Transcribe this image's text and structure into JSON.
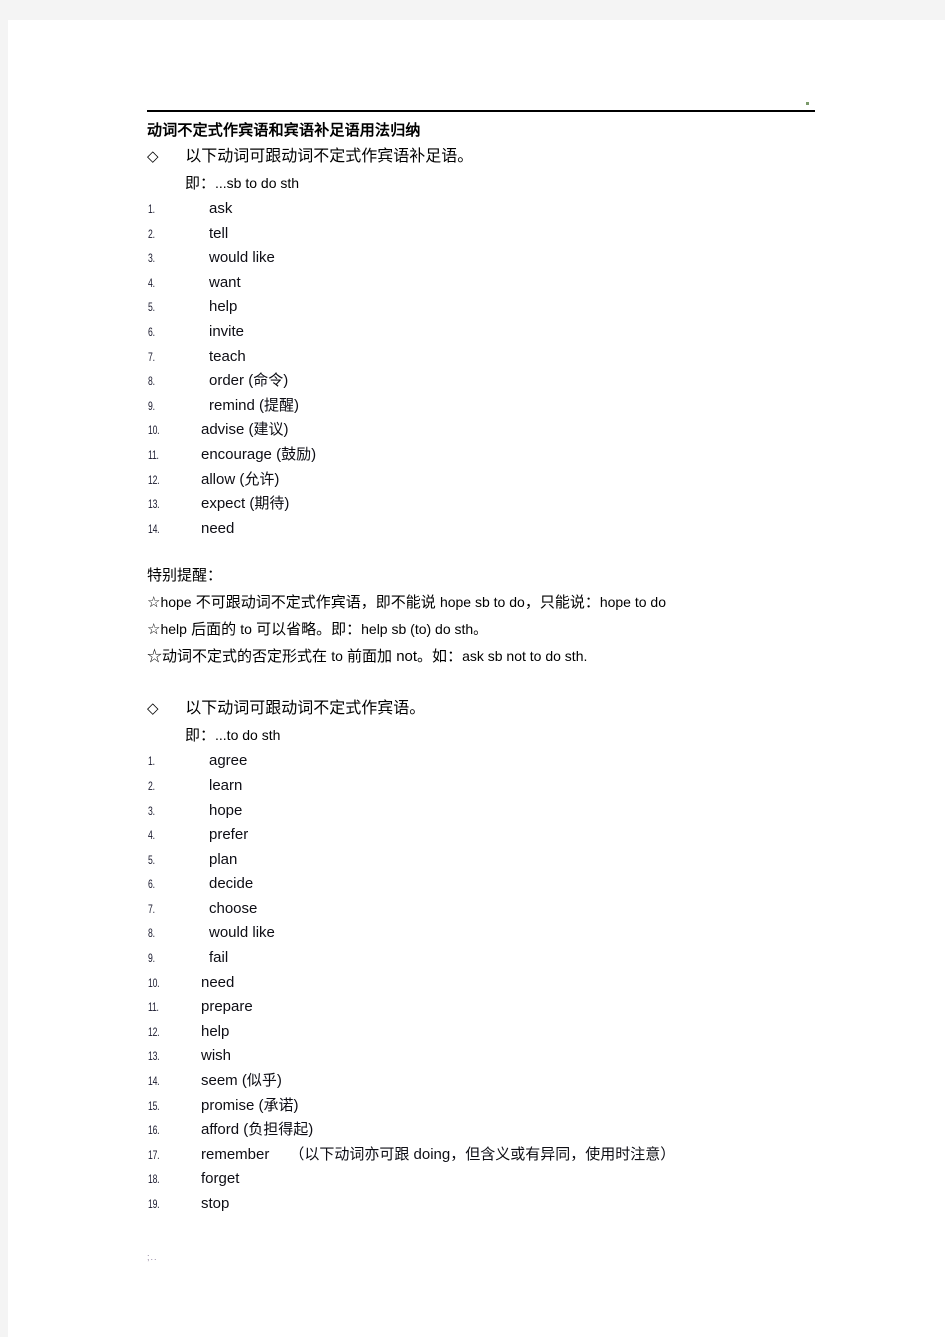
{
  "document": {
    "title": "动词不定式作宾语和宾语补足语用法归纳",
    "footer_mark": ";.."
  },
  "section1": {
    "bullet": "◇",
    "heading": "以下动词可跟动词不定式作宾语补足语。",
    "formula_label": "即：",
    "formula": "...sb to do sth",
    "items": [
      {
        "num": "1.",
        "word": "ask",
        "gloss": ""
      },
      {
        "num": "2.",
        "word": "tell",
        "gloss": ""
      },
      {
        "num": "3.",
        "word": "would like",
        "gloss": ""
      },
      {
        "num": "4.",
        "word": "want",
        "gloss": ""
      },
      {
        "num": "5.",
        "word": "help",
        "gloss": ""
      },
      {
        "num": "6.",
        "word": "invite",
        "gloss": ""
      },
      {
        "num": "7.",
        "word": "teach",
        "gloss": ""
      },
      {
        "num": "8.",
        "word": "order",
        "gloss": "(命令)"
      },
      {
        "num": "9.",
        "word": "remind",
        "gloss": "(提醒)"
      },
      {
        "num": "10.",
        "word": "advise",
        "gloss": "(建议)"
      },
      {
        "num": "11.",
        "word": "encourage",
        "gloss": "(鼓励)"
      },
      {
        "num": "12.",
        "word": "allow",
        "gloss": "(允许)"
      },
      {
        "num": "13.",
        "word": "expect",
        "gloss": "(期待)"
      },
      {
        "num": "14.",
        "word": "need",
        "gloss": ""
      }
    ]
  },
  "notes": {
    "title": "特别提醒：",
    "lines": [
      {
        "star": "☆",
        "part1": "hope",
        "part2": " 不可跟动词不定式作宾语，即不能说 ",
        "latin1": "hope sb to do",
        "part3": "，只能说：",
        "latin2": "hope to do"
      },
      {
        "star": "☆",
        "part1": "help",
        "part2": " 后面的 ",
        "latin1": "to",
        "part3": " 可以省略。即：",
        "latin2": "help sb (to) do sth。"
      },
      {
        "star": "☆",
        "part1": "",
        "part2": "动词不定式的否定形式在 ",
        "latin1": "to",
        "part3": " 前面加 not。如：",
        "latin2": "ask sb not to do sth."
      }
    ]
  },
  "section2": {
    "bullet": "◇",
    "heading": "以下动词可跟动词不定式作宾语。",
    "formula_label": "即：",
    "formula": "...to do sth",
    "items": [
      {
        "num": "1.",
        "word": "agree",
        "gloss": "",
        "note": ""
      },
      {
        "num": "2.",
        "word": "learn",
        "gloss": "",
        "note": ""
      },
      {
        "num": "3.",
        "word": "hope",
        "gloss": "",
        "note": ""
      },
      {
        "num": "4.",
        "word": "prefer",
        "gloss": "",
        "note": ""
      },
      {
        "num": "5.",
        "word": "plan",
        "gloss": "",
        "note": ""
      },
      {
        "num": "6.",
        "word": "decide",
        "gloss": "",
        "note": ""
      },
      {
        "num": "7.",
        "word": "choose",
        "gloss": "",
        "note": ""
      },
      {
        "num": "8.",
        "word": "would like",
        "gloss": "",
        "note": ""
      },
      {
        "num": "9.",
        "word": "fail",
        "gloss": "",
        "note": ""
      },
      {
        "num": "10.",
        "word": "need",
        "gloss": "",
        "note": ""
      },
      {
        "num": "11.",
        "word": "prepare",
        "gloss": "",
        "note": ""
      },
      {
        "num": "12.",
        "word": "help",
        "gloss": "",
        "note": ""
      },
      {
        "num": "13.",
        "word": "wish",
        "gloss": "",
        "note": ""
      },
      {
        "num": "14.",
        "word": "seem",
        "gloss": "(似乎)",
        "note": ""
      },
      {
        "num": "15.",
        "word": "promise",
        "gloss": "(承诺)",
        "note": ""
      },
      {
        "num": "16.",
        "word": "afford",
        "gloss": "(负担得起)",
        "note": ""
      },
      {
        "num": "17.",
        "word": "remember",
        "gloss": "",
        "note": "（以下动词亦可跟 doing，但含义或有异同，使用时注意）"
      },
      {
        "num": "18.",
        "word": "forget",
        "gloss": "",
        "note": ""
      },
      {
        "num": "19.",
        "word": "stop",
        "gloss": "",
        "note": ""
      }
    ]
  }
}
